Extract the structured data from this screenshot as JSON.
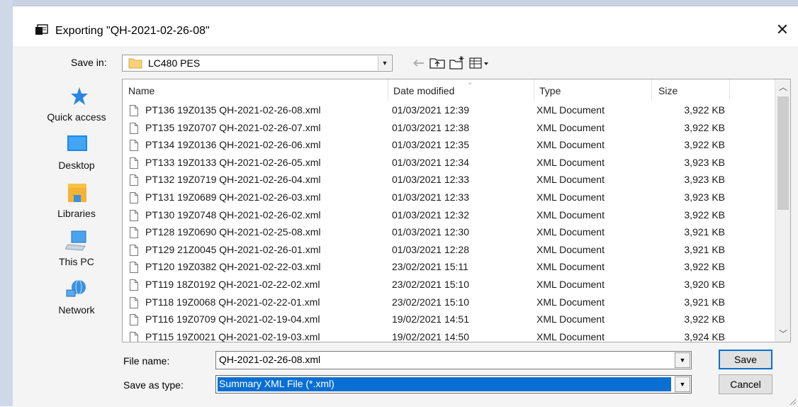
{
  "dialog": {
    "title": "Exporting \"QH-2021-02-26-08\"",
    "close_glyph": "✕"
  },
  "save_in": {
    "label": "Save in:",
    "value": "LC480 PES",
    "icon": "folder-icon"
  },
  "toolbar": {
    "back_icon": "back-arrow-icon",
    "up_icon": "up-folder-icon",
    "new_folder_icon": "new-folder-icon",
    "view_icon": "view-menu-icon"
  },
  "places": [
    {
      "label": "Quick access",
      "icon": "star-icon"
    },
    {
      "label": "Desktop",
      "icon": "desktop-icon"
    },
    {
      "label": "Libraries",
      "icon": "libraries-icon"
    },
    {
      "label": "This PC",
      "icon": "computer-icon"
    },
    {
      "label": "Network",
      "icon": "network-icon"
    }
  ],
  "columns": {
    "name": "Name",
    "date": "Date modified",
    "type": "Type",
    "size": "Size"
  },
  "files": [
    {
      "name": "PT136 19Z0135 QH-2021-02-26-08.xml",
      "date": "01/03/2021 12:39",
      "type": "XML Document",
      "size": "3,922 KB"
    },
    {
      "name": "PT135 19Z0707 QH-2021-02-26-07.xml",
      "date": "01/03/2021 12:38",
      "type": "XML Document",
      "size": "3,922 KB"
    },
    {
      "name": "PT134 19Z0136 QH-2021-02-26-06.xml",
      "date": "01/03/2021 12:35",
      "type": "XML Document",
      "size": "3,922 KB"
    },
    {
      "name": "PT133 19Z0133 QH-2021-02-26-05.xml",
      "date": "01/03/2021 12:34",
      "type": "XML Document",
      "size": "3,923 KB"
    },
    {
      "name": "PT132 19Z0719 QH-2021-02-26-04.xml",
      "date": "01/03/2021 12:33",
      "type": "XML Document",
      "size": "3,923 KB"
    },
    {
      "name": "PT131 19Z0689 QH-2021-02-26-03.xml",
      "date": "01/03/2021 12:33",
      "type": "XML Document",
      "size": "3,923 KB"
    },
    {
      "name": "PT130 19Z0748 QH-2021-02-26-02.xml",
      "date": "01/03/2021 12:32",
      "type": "XML Document",
      "size": "3,922 KB"
    },
    {
      "name": "PT128 19Z0690 QH-2021-02-25-08.xml",
      "date": "01/03/2021 12:30",
      "type": "XML Document",
      "size": "3,921 KB"
    },
    {
      "name": "PT129 21Z0045 QH-2021-02-26-01.xml",
      "date": "01/03/2021 12:28",
      "type": "XML Document",
      "size": "3,921 KB"
    },
    {
      "name": "PT120 19Z0382 QH-2021-02-22-03.xml",
      "date": "23/02/2021 15:11",
      "type": "XML Document",
      "size": "3,922 KB"
    },
    {
      "name": "PT119 18Z0192 QH-2021-02-22-02.xml",
      "date": "23/02/2021 15:10",
      "type": "XML Document",
      "size": "3,920 KB"
    },
    {
      "name": "PT118 19Z0068 QH-2021-02-22-01.xml",
      "date": "23/02/2021 15:10",
      "type": "XML Document",
      "size": "3,921 KB"
    },
    {
      "name": "PT116 19Z0709 QH-2021-02-19-04.xml",
      "date": "19/02/2021 14:51",
      "type": "XML Document",
      "size": "3,922 KB"
    },
    {
      "name": "PT115 19Z0021 QH-2021-02-19-03.xml",
      "date": "19/02/2021 14:50",
      "type": "XML Document",
      "size": "3,924 KB"
    }
  ],
  "file_name": {
    "label": "File name:",
    "value": "QH-2021-02-26-08.xml"
  },
  "save_as_type": {
    "label": "Save as type:",
    "value": "Summary XML File (*.xml)"
  },
  "buttons": {
    "save": "Save",
    "cancel": "Cancel"
  },
  "colors": {
    "selection": "#0a6fd2",
    "folder": "#f2c94c",
    "accent_blue": "#1e88e5"
  }
}
